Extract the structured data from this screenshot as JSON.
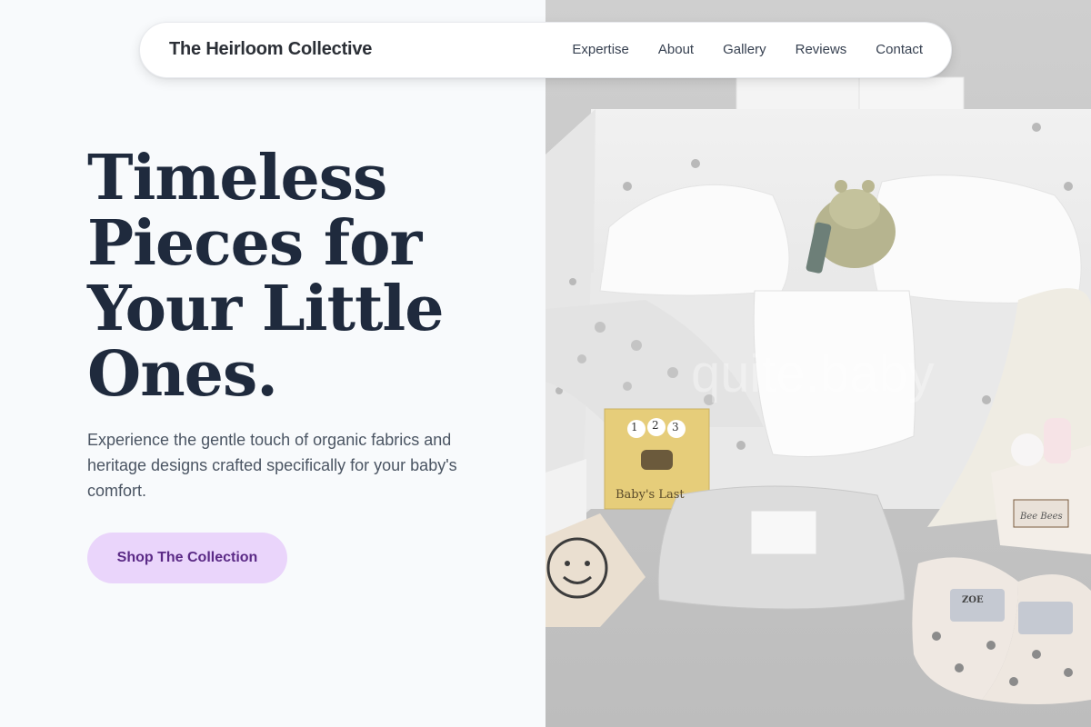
{
  "brand": {
    "name": "The Heirloom Collective"
  },
  "nav": {
    "links": [
      "Expertise",
      "About",
      "Gallery",
      "Reviews",
      "Contact"
    ]
  },
  "hero": {
    "title": "Timeless Pieces for Your Little Ones.",
    "subtitle": "Experience the gentle touch of organic fabrics and heritage designs crafted specifically for your baby's comfort.",
    "cta_label": "Shop The Collection"
  },
  "image": {
    "watermark": "quite.baby",
    "book_title": "Baby's Last",
    "book_numbers": [
      "1",
      "2",
      "3"
    ],
    "gift_tag": "Bee Bees",
    "blanket_tag": "ZOE"
  },
  "colors": {
    "background": "#f8fafc",
    "title": "#1f2a3d",
    "cta_bg": "#ead5fb",
    "cta_text": "#5b2a86"
  }
}
